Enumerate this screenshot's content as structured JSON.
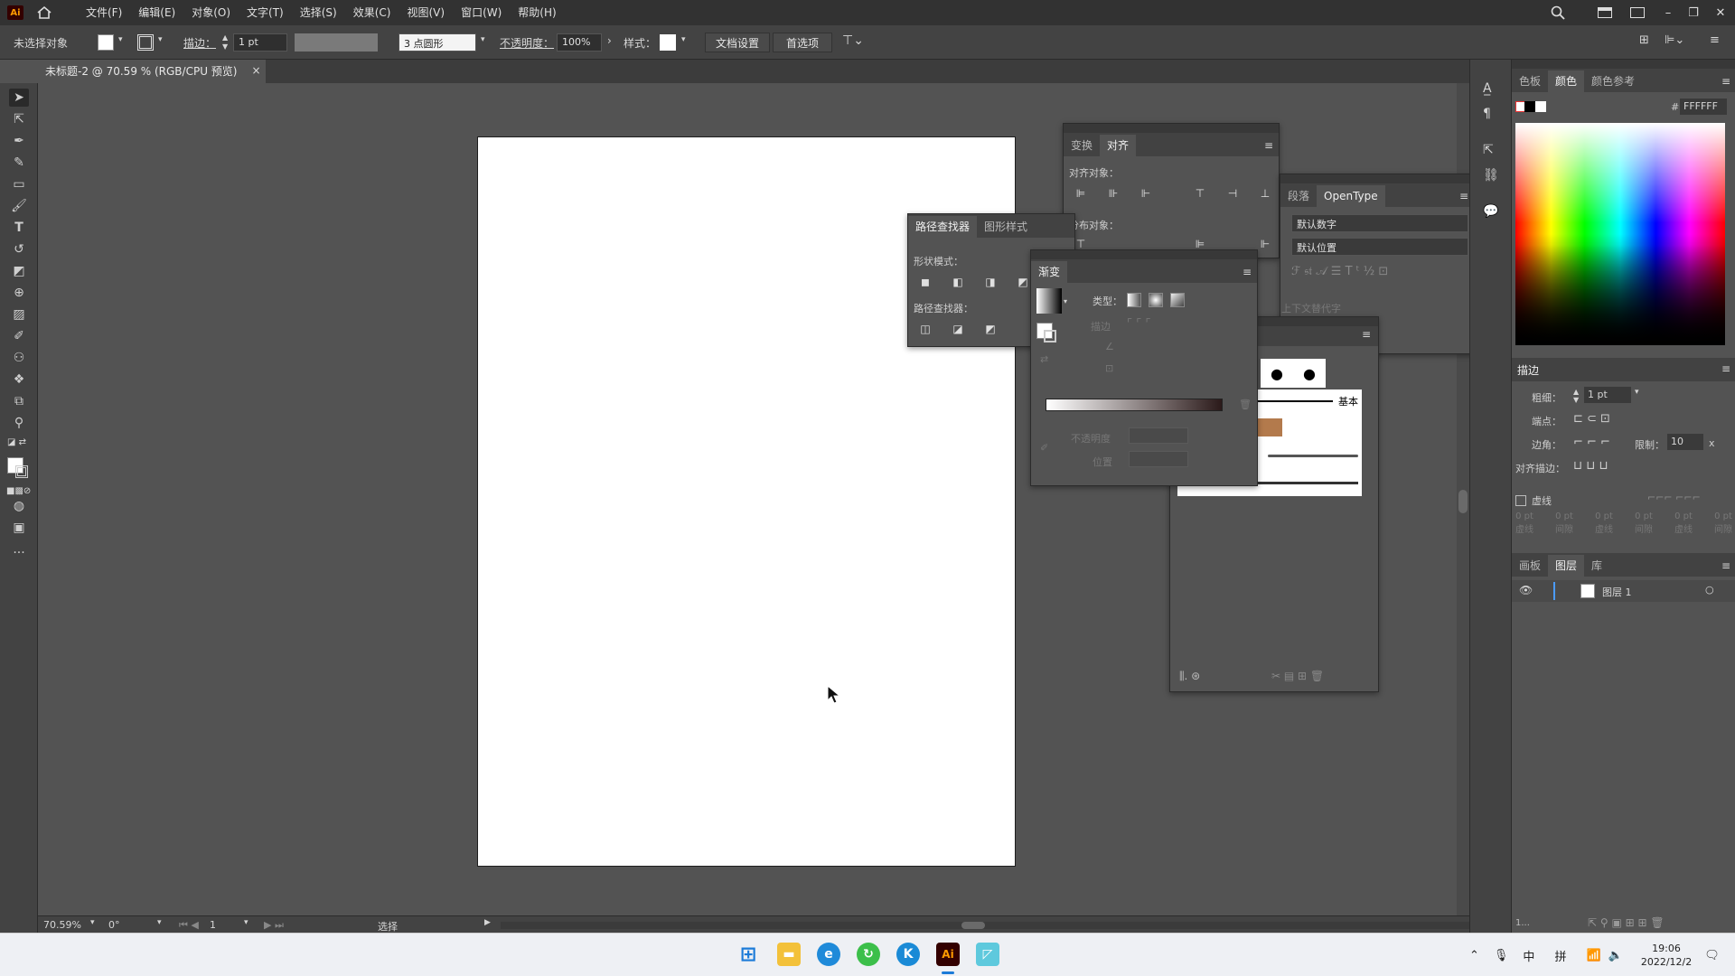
{
  "app": {
    "logo": "Ai",
    "menu": [
      "文件(F)",
      "编辑(E)",
      "对象(O)",
      "文字(T)",
      "选择(S)",
      "效果(C)",
      "视图(V)",
      "窗口(W)",
      "帮助(H)"
    ]
  },
  "controlbar": {
    "selection": "未选择对象",
    "stroke_label": "描边：",
    "stroke_value": "1 pt",
    "brush": "3 点圆形",
    "opacity_label": "不透明度：",
    "opacity_value": "100%",
    "style_label": "样式：",
    "doc_setup": "文档设置",
    "prefs": "首选项"
  },
  "document": {
    "tab_title": "未标题-2 @ 70.59 % (RGB/CPU 预览)",
    "close": "×"
  },
  "align_panel": {
    "tabs": [
      "变换",
      "对齐"
    ],
    "align_objects": "对齐对象：",
    "distribute_objects": "分布对象："
  },
  "pathfinder_panel": {
    "tabs": [
      "路径查找器",
      "图形样式"
    ],
    "shape_modes": "形状模式：",
    "pathfinders": "路径查找器："
  },
  "gradient_panel": {
    "tab": "渐变",
    "type_label": "类型：",
    "stroke_label": "描边",
    "opacity_label": "不透明度",
    "location_label": "位置"
  },
  "opentype_panel": {
    "tabs": [
      "段落",
      "OpenType"
    ],
    "figure": "默认数字",
    "position": "默认位置",
    "hint": "上下文替代字"
  },
  "brushes_panel": {
    "basic": "基本"
  },
  "color_panel": {
    "tabs": [
      "色板",
      "颜色",
      "颜色参考"
    ],
    "hex_prefix": "#",
    "hex": "FFFFFF"
  },
  "stroke_panel": {
    "title": "描边",
    "weight_label": "粗细：",
    "weight_value": "1 pt",
    "cap_label": "端点：",
    "corner_label": "边角：",
    "limit_label": "限制：",
    "limit_value": "10",
    "limit_unit": "x",
    "align_label": "对齐描边：",
    "dashed_label": "虚线",
    "dash_values": [
      "0 pt",
      "0 pt",
      "0 pt",
      "0 pt",
      "0 pt",
      "0 pt"
    ],
    "dash_labels": [
      "虚线",
      "间隙",
      "虚线",
      "间隙",
      "虚线",
      "间隙"
    ]
  },
  "layers_panel": {
    "tabs": [
      "画板",
      "图层",
      "库"
    ],
    "layer_name": "图层 1",
    "footer": "1..."
  },
  "status": {
    "zoom": "70.59%",
    "rotation": "0°",
    "artboard": "1",
    "mode": "选择"
  },
  "taskbar": {
    "time": "19:06",
    "date": "2022/12/2",
    "ime1": "中",
    "ime2": "拼"
  },
  "colors": {
    "accent": "#4b9bff",
    "panel": "#535353",
    "dark": "#323232"
  }
}
